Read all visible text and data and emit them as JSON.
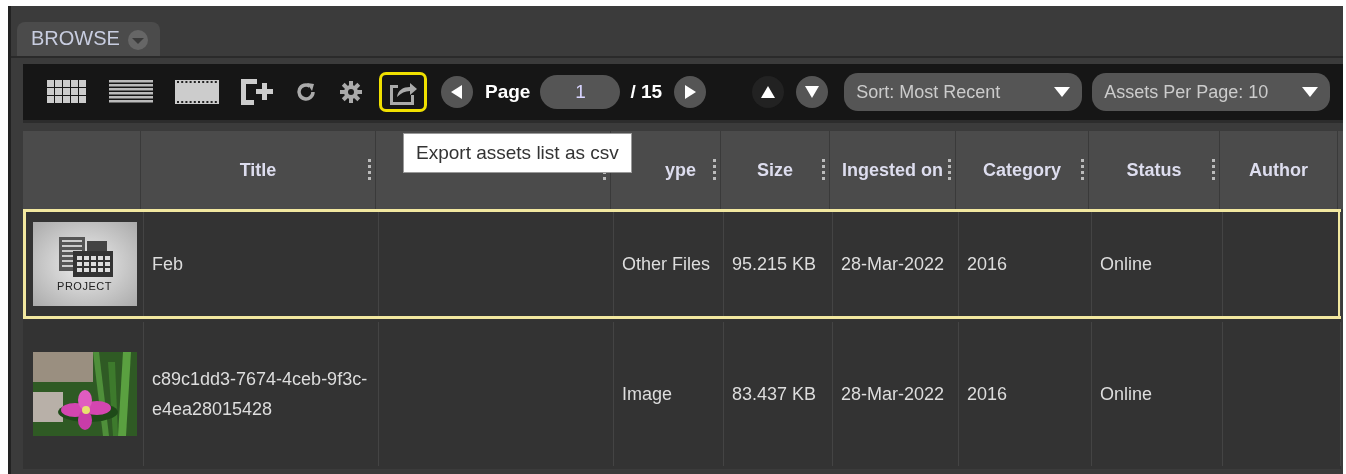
{
  "tab": {
    "label": "BROWSE"
  },
  "toolbar_buttons": [
    {
      "kind": "grid",
      "highlighted": false
    },
    {
      "kind": "list",
      "highlighted": false
    },
    {
      "kind": "filmstrip",
      "highlighted": false
    },
    {
      "kind": "add",
      "highlighted": false
    },
    {
      "kind": "refresh",
      "highlighted": false
    },
    {
      "kind": "settings",
      "highlighted": false
    },
    {
      "kind": "export",
      "highlighted": true
    }
  ],
  "pager": {
    "label": "Page",
    "value": "1",
    "total": "/ 15"
  },
  "sort": {
    "label": "Sort: Most Recent"
  },
  "per_page": {
    "label": "Assets Per Page: 10"
  },
  "tooltip": "Export assets list as csv",
  "table": {
    "columns": [
      {},
      {
        "label": "Title"
      },
      {},
      {
        "label": "ype"
      },
      {
        "label": "Size"
      },
      {
        "label": "Ingested on"
      },
      {
        "label": "Category"
      },
      {
        "label": "Status"
      },
      {
        "label": "Author"
      }
    ],
    "rows": [
      {
        "selected": true,
        "cells": [
          {
            "kind": "project",
            "label": "PROJECT"
          },
          "Feb",
          "",
          "Other Files",
          "95.215 KB",
          "28-Mar-2022",
          "2016",
          "Online",
          ""
        ]
      },
      {
        "selected": false,
        "cells": [
          {
            "kind": "picture"
          },
          "c89c1dd3-7674-4ceb-9f3c-e4ea28015428",
          "",
          "Image",
          "83.437 KB",
          "28-Mar-2022",
          "2016",
          "Online",
          ""
        ]
      }
    ]
  }
}
